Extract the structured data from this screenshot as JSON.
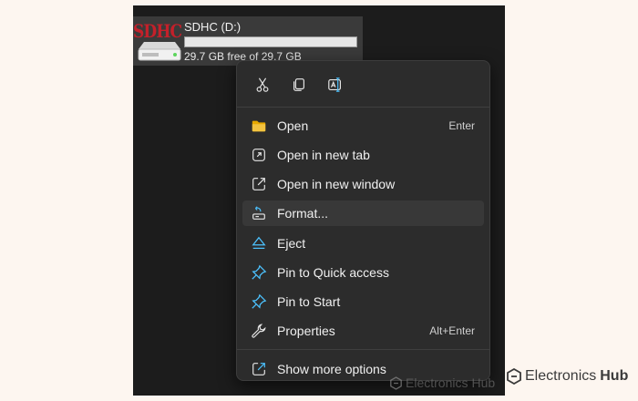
{
  "drive": {
    "logo_text": "SDHC",
    "name": "SDHC (D:)",
    "free_text": "29.7 GB free of 29.7 GB",
    "used_fraction": 0.0
  },
  "quick_actions": [
    {
      "icon": "scissors-icon",
      "name": "cut"
    },
    {
      "icon": "copy-icon",
      "name": "copy"
    },
    {
      "icon": "rename-icon",
      "name": "rename"
    }
  ],
  "menu": {
    "items": [
      {
        "label": "Open",
        "shortcut": "Enter",
        "icon": "folder-icon"
      },
      {
        "label": "Open in new tab",
        "shortcut": "",
        "icon": "new-tab-icon"
      },
      {
        "label": "Open in new window",
        "shortcut": "",
        "icon": "new-window-icon"
      },
      {
        "label": "Format...",
        "shortcut": "",
        "icon": "format-icon"
      },
      {
        "label": "Eject",
        "shortcut": "",
        "icon": "eject-icon"
      },
      {
        "label": "Pin to Quick access",
        "shortcut": "",
        "icon": "pin-icon"
      },
      {
        "label": "Pin to Start",
        "shortcut": "",
        "icon": "pin-icon"
      },
      {
        "label": "Properties",
        "shortcut": "Alt+Enter",
        "icon": "wrench-icon"
      },
      {
        "label": "Show more options",
        "shortcut": "",
        "icon": "more-options-icon"
      }
    ]
  },
  "watermark": {
    "part1": "Electronics",
    "part2": "Hub"
  },
  "colors": {
    "accent_blue": "#4cc2ff",
    "folder_yellow": "#f3c340",
    "menu_bg": "#2c2c2c",
    "hover_bg": "#383838"
  }
}
